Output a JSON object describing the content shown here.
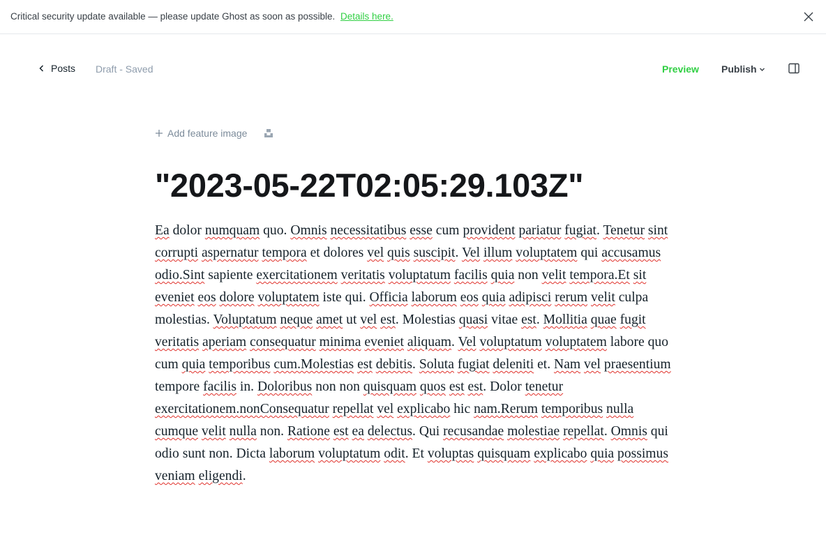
{
  "banner": {
    "message": "Critical security update available — please update Ghost as soon as possible.",
    "link_label": "Details here."
  },
  "editor_header": {
    "back_label": "Posts",
    "status": "Draft - Saved",
    "preview_label": "Preview",
    "publish_label": "Publish"
  },
  "feature_image": {
    "add_label": "Add feature image"
  },
  "post": {
    "title": "\"2023-05-22T02:05:29.103Z\"",
    "body": "Ea dolor numquam quo. Omnis necessitatibus esse cum provident pariatur fugiat. Tenetur sint corrupti aspernatur tempora et dolores vel quis suscipit. Vel illum voluptatem qui accusamus odio.Sint sapiente exercitationem veritatis voluptatum facilis quia non velit tempora.Et sit eveniet eos dolore voluptatem iste qui. Officia laborum eos quia adipisci rerum velit culpa molestias. Voluptatum neque amet ut vel est. Molestias quasi vitae est. Mollitia quae fugit veritatis aperiam consequatur minima eveniet aliquam. Vel voluptatum voluptatem labore quo cum quia temporibus cum.Molestias est debitis. Soluta fugiat deleniti et. Nam vel praesentium tempore facilis in. Doloribus non non quisquam quos est est. Dolor tenetur exercitationem.nonConsequatur repellat vel explicabo hic nam.Rerum temporibus nulla cumque velit nulla non. Ratione est ea delectus. Qui recusandae molestiae repellat. Omnis qui odio sunt non. Dicta laborum voluptatum odit. Et voluptas quisquam explicabo quia possimus veniam eligendi.",
    "misspelled": [
      "Ea",
      "numquam",
      "Omnis",
      "necessitatibus",
      "esse",
      "provident",
      "pariatur",
      "fugiat",
      "Tenetur",
      "sint",
      "corrupti",
      "aspernatur",
      "tempora",
      "vel",
      "quis",
      "suscipit",
      "Vel",
      "illum",
      "voluptatem",
      "accusamus",
      "odio.Sint",
      "exercitationem",
      "veritatis",
      "voluptatum",
      "facilis",
      "quia",
      "velit",
      "tempora.Et",
      "sit",
      "eveniet",
      "eos",
      "dolore",
      "Officia",
      "laborum",
      "adipisci",
      "rerum",
      "Voluptatum",
      "neque",
      "amet",
      "est",
      "quasi",
      "Mollitia",
      "quae",
      "fugit",
      "aperiam",
      "consequatur",
      "minima",
      "aliquam",
      "temporibus",
      "cum.Molestias",
      "debitis",
      "Soluta",
      "deleniti",
      "Nam",
      "praesentium",
      "Doloribus",
      "quisquam",
      "quos",
      "tenetur",
      "exercitationem.nonConsequatur",
      "repellat",
      "explicabo",
      "nam.Rerum",
      "nulla",
      "cumque",
      "Ratione",
      "ea",
      "delectus",
      "recusandae",
      "molestiae",
      "odit",
      "voluptas",
      "possimus",
      "veniam",
      "eligendi"
    ]
  },
  "colors": {
    "accent_green": "#30cf43",
    "spellcheck_red": "#e0312b",
    "muted_text": "#8e9cac"
  }
}
